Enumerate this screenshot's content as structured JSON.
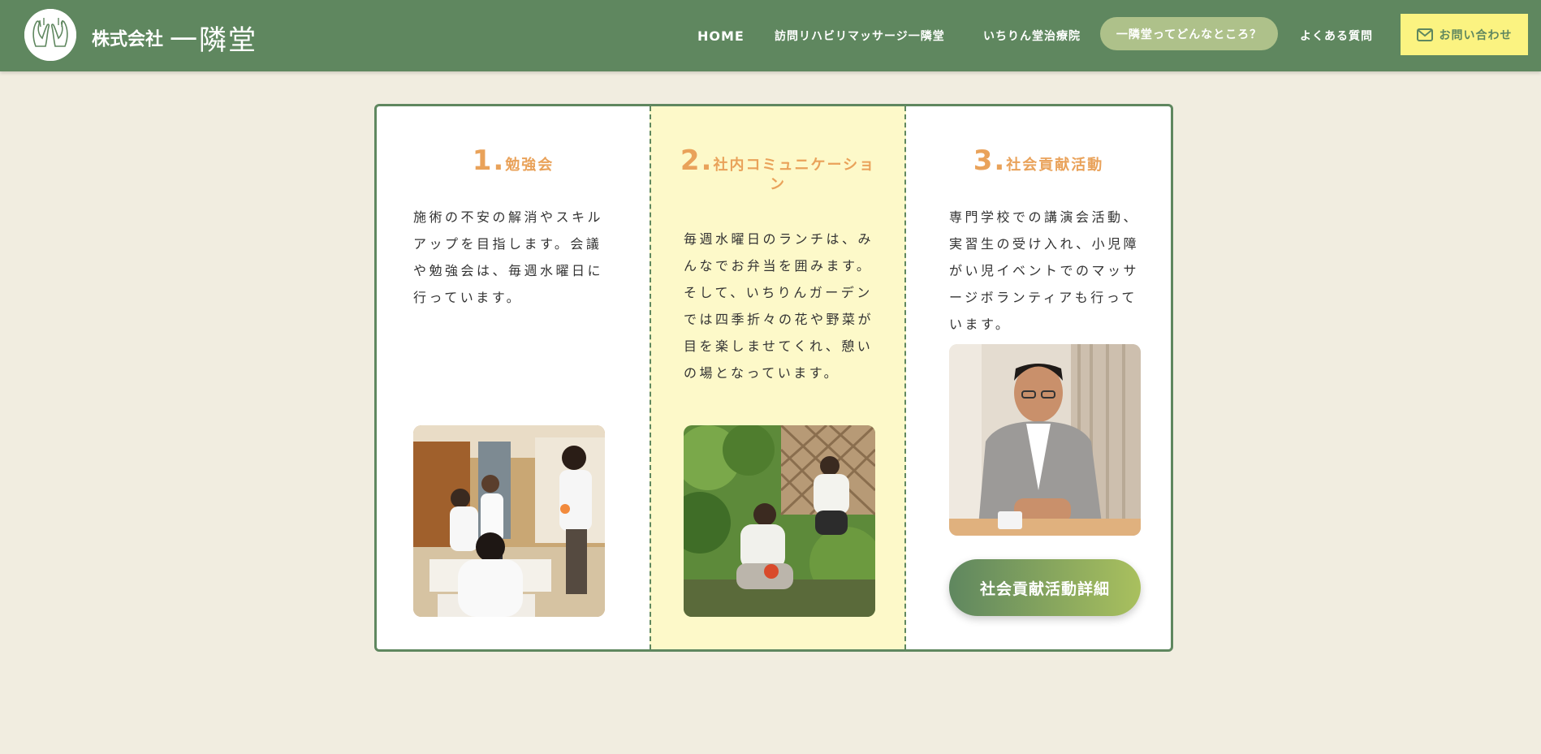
{
  "header": {
    "logo_small": "株式会社",
    "logo_big": "一隣堂",
    "nav": {
      "home": "HOME",
      "visit": "訪問リハビリマッサージ一隣堂",
      "clinic": "いちりん堂治療院",
      "about": "一隣堂ってどんなところ？",
      "faq": "よくある質問",
      "contact": "お問い合わせ"
    }
  },
  "columns": [
    {
      "number": "1.",
      "title": "勉強会",
      "text": [
        "施術の不安の解消やスキル",
        "アップを目指します。会議",
        "や勉強会は、毎週水曜日に",
        "行っています。"
      ],
      "photo": "treatment-training-photo"
    },
    {
      "number": "2.",
      "title_line1": "社内コミュニケーショ",
      "title_line2": "ン",
      "text": [
        "毎週水曜日のランチは、み",
        "んなでお弁当を囲みます。",
        "そして、いちりんガーデン",
        "では四季折々の花や野菜が",
        "目を楽しませてくれ、憩い",
        "の場となっています。"
      ],
      "photo": "garden-photo"
    },
    {
      "number": "3.",
      "title": "社会貢献活動",
      "text": [
        "専門学校での講演会活動、",
        "実習生の受け入れ、小児障",
        "がい児イベントでのマッサ",
        "ージボランティアも行って",
        "います。"
      ],
      "photo": "interview-photo",
      "button": "社会貢献活動詳細"
    }
  ],
  "colors": {
    "header_green": "#5f875f",
    "accent_orange": "#e9a25a",
    "highlight_yellow": "#fdf9c9",
    "contact_yellow": "#fbf381",
    "page_bg": "#f1ede0"
  }
}
